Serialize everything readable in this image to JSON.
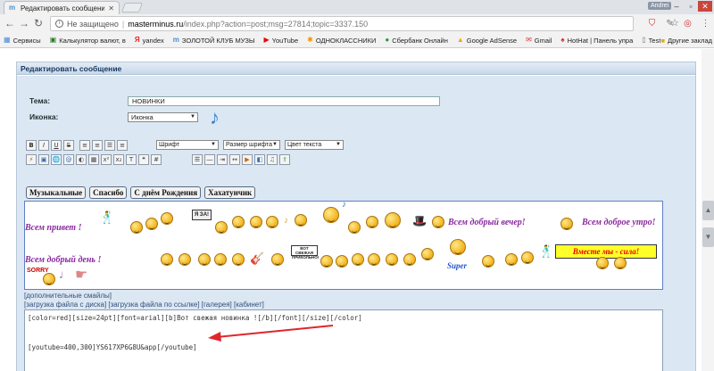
{
  "browser": {
    "tab_title": "Редактировать сообщение",
    "profile_label": "Andrei",
    "security_label": "Не защищено",
    "url_host": "masterminus.ru",
    "url_path": "/index.php?action=post;msg=27814;topic=3337.150",
    "bookmarks": [
      {
        "label": "Сервисы",
        "icon": "apps-icon"
      },
      {
        "label": "Калькулятор валют, в",
        "icon": "calculator-icon"
      },
      {
        "label": "yandex",
        "icon": "yandex-icon"
      },
      {
        "label": "ЗОЛОТОЙ КЛУБ МУЗЫ",
        "icon": "site-icon"
      },
      {
        "label": "YouTube",
        "icon": "youtube-icon"
      },
      {
        "label": "ОДНОКЛАССНИКИ",
        "icon": "ok-icon"
      },
      {
        "label": "Сбербанк Онлайн",
        "icon": "sber-icon"
      },
      {
        "label": "Google AdSense",
        "icon": "adsense-icon"
      },
      {
        "label": "Gmail",
        "icon": "gmail-icon"
      },
      {
        "label": "HotHat | Панель упра",
        "icon": "hothat-icon"
      },
      {
        "label": "Test",
        "icon": "page-icon"
      }
    ],
    "other_bookmarks": "Другие заклад"
  },
  "form": {
    "title": "Редактировать сообщение",
    "subject_label": "Тема:",
    "subject_value": "НОВИНКИ",
    "icon_label": "Иконка:",
    "icon_value": "Иконка",
    "font_select": "Шрифт",
    "size_select": "Размер шрифта",
    "color_select": "Цвет текста",
    "smiley_tabs": [
      "Музыкальные",
      "Спасибо",
      "С днём Рождения",
      "Хахатунчик"
    ],
    "smiley_signs": {
      "hello": "Всем привет !",
      "good_evening": "Всем добрый вечер!",
      "good_morning": "Всем доброе утро!",
      "good_day": "Всем добрый день !",
      "together": "Вместе мы - сила!",
      "super": "Super",
      "plate1": "Я ЗА!",
      "plate2": "ВОТ СВЕЖАЯ ПРИКОЛЬНО!",
      "sticker": "SORRY"
    },
    "extra_smileys_link": "[дополнительные смайлы]",
    "upload_links": "[загрузка файла с диска] [загрузка файла по ссылке] [галерея] [кабинет]",
    "editor_lines": [
      "[color=red][size=24pt][font=arial][b]Вот свежая новинка ![/b][/font][/size][/color]",
      "",
      "",
      "[youtube=400,300]YS617XP6G8U&app[/youtube]"
    ]
  },
  "colors": {
    "panel_bg": "#dbe7f3",
    "arrow": "#e0262b",
    "banner_bg": "#ffff2a",
    "banner_text": "#e00000",
    "sign_text": "#8a2aa0"
  }
}
